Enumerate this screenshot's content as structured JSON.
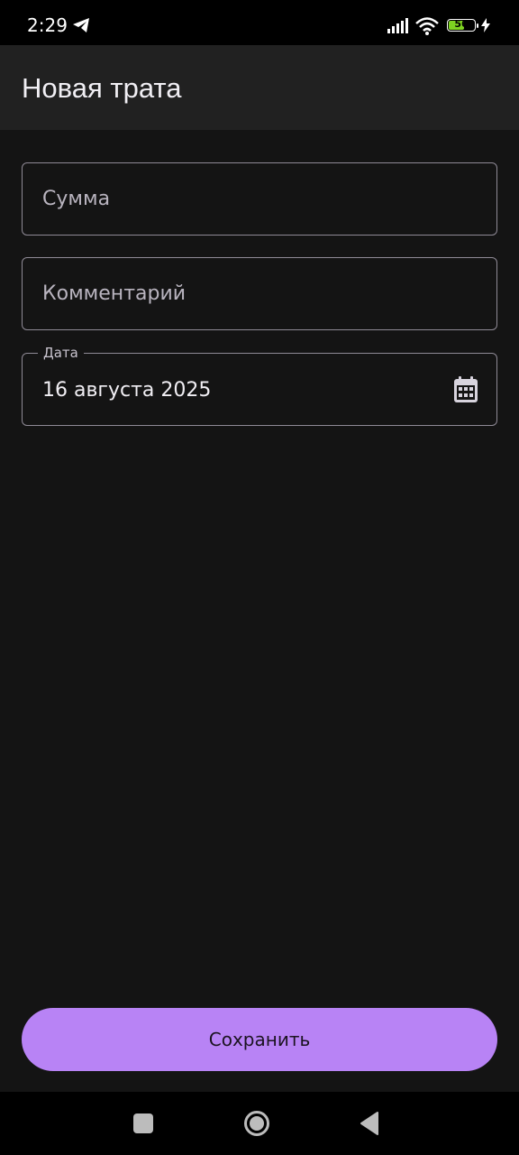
{
  "status": {
    "time": "2:29",
    "battery": "56",
    "icons": [
      "telegram-icon",
      "signal-icon",
      "wifi-icon",
      "battery-icon",
      "charging-icon"
    ]
  },
  "app_bar": {
    "title": "Новая трата"
  },
  "form": {
    "amount": {
      "placeholder": "Сумма",
      "value": ""
    },
    "comment": {
      "placeholder": "Комментарий",
      "value": ""
    },
    "date": {
      "label": "Дата",
      "value": "16 августа 2025",
      "icon": "calendar-icon"
    }
  },
  "actions": {
    "save_label": "Сохранить"
  },
  "nav": {
    "icons": [
      "recent-apps-icon",
      "home-icon",
      "back-icon"
    ]
  },
  "colors": {
    "background": "#141414",
    "app_bar": "#212121",
    "accent": "#b883f5",
    "outline": "#8f8a96"
  }
}
